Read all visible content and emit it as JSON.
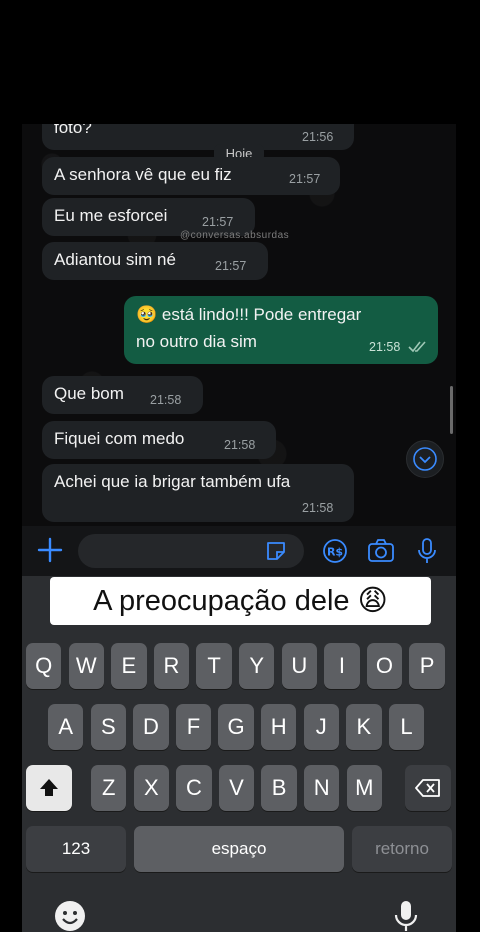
{
  "chat": {
    "date_chip": "Hoje",
    "watermark": "@conversas.absurdas",
    "messages": [
      {
        "text": "foto?",
        "time": "21:56",
        "direction": "in"
      },
      {
        "text": "A senhora vê que eu fiz",
        "time": "21:57",
        "direction": "in"
      },
      {
        "text": "Eu me esforcei",
        "time": "21:57",
        "direction": "in"
      },
      {
        "text": "Adiantou sim né",
        "time": "21:57",
        "direction": "in"
      },
      {
        "text_line1": "🥹 está lindo!!! Pode entregar",
        "text_line2": "no outro dia sim",
        "time": "21:58",
        "direction": "out",
        "status": "read"
      },
      {
        "text": "Que bom",
        "time": "21:58",
        "direction": "in"
      },
      {
        "text": "Fiquei com medo",
        "time": "21:58",
        "direction": "in"
      },
      {
        "text": "Achei que ia brigar também ufa",
        "time": "21:58",
        "direction": "in"
      }
    ]
  },
  "input_bar": {
    "icons": [
      "plus-icon",
      "sticker-icon",
      "pix-icon",
      "camera-icon",
      "microphone-icon"
    ]
  },
  "caption": "A preocupação dele 😩",
  "keyboard": {
    "row1": [
      "Q",
      "W",
      "E",
      "R",
      "T",
      "Y",
      "U",
      "I",
      "O",
      "P"
    ],
    "row2": [
      "A",
      "S",
      "D",
      "F",
      "G",
      "H",
      "J",
      "K",
      "L"
    ],
    "row3": [
      "Z",
      "X",
      "C",
      "V",
      "B",
      "N",
      "M"
    ],
    "numbers_label": "123",
    "space_label": "espaço",
    "return_label": "retorno"
  },
  "colors": {
    "incoming_bubble": "#1f2225",
    "outgoing_bubble": "#135c43",
    "accent_blue": "#3a8bff"
  }
}
